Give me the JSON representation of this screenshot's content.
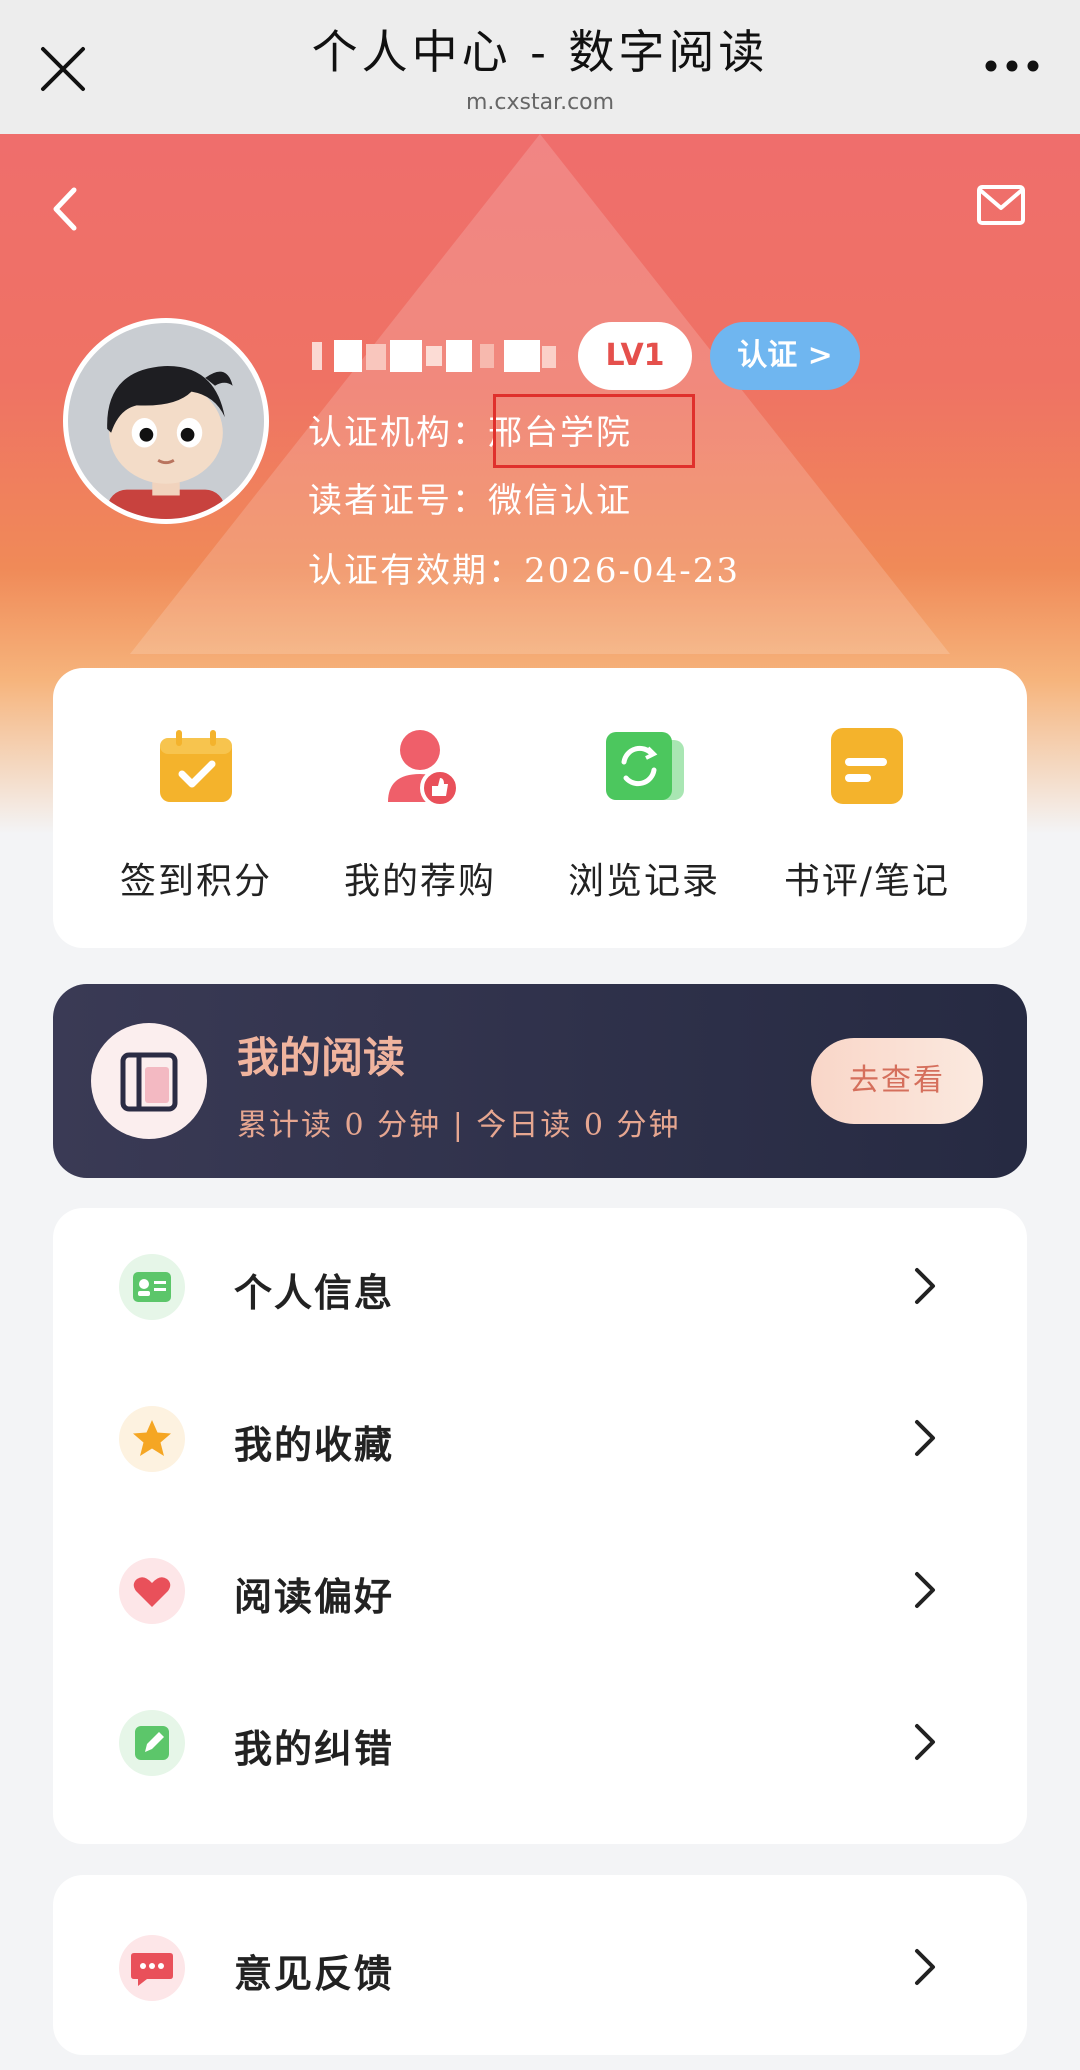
{
  "topbar": {
    "title": "个人中心 - 数字阅读",
    "url": "m.cxstar.com"
  },
  "profile": {
    "level": "LV1",
    "certify_label": "认证 >",
    "rows": [
      {
        "label": "认证机构：",
        "value": "邢台学院"
      },
      {
        "label": "读者证号：",
        "value": "微信认证"
      },
      {
        "label": "认证有效期：",
        "value": "2026-04-23"
      }
    ]
  },
  "quick_actions": [
    {
      "label": "签到积分",
      "icon": "calendar-check-icon"
    },
    {
      "label": "我的荐购",
      "icon": "user-thumbs-up-icon"
    },
    {
      "label": "浏览记录",
      "icon": "refresh-history-icon"
    },
    {
      "label": "书评/笔记",
      "icon": "note-icon"
    }
  ],
  "reading": {
    "title": "我的阅读",
    "summary": "累计读 0 分钟 | 今日读 0 分钟",
    "button": "去查看"
  },
  "menu": [
    {
      "label": "个人信息",
      "icon": "id-card-icon",
      "color": "#5cc66a"
    },
    {
      "label": "我的收藏",
      "icon": "star-icon",
      "color": "#f5a623"
    },
    {
      "label": "阅读偏好",
      "icon": "heart-icon",
      "color": "#e9505a"
    },
    {
      "label": "我的纠错",
      "icon": "edit-icon",
      "color": "#5cc66a"
    }
  ],
  "feedback": {
    "label": "意见反馈",
    "icon": "message-icon",
    "color": "#e9505a"
  },
  "colors": {
    "hero": "#ef6e6c",
    "accent": "#e5504c",
    "reading_bg": "#2d2f48",
    "certify": "#6fb6f0"
  }
}
